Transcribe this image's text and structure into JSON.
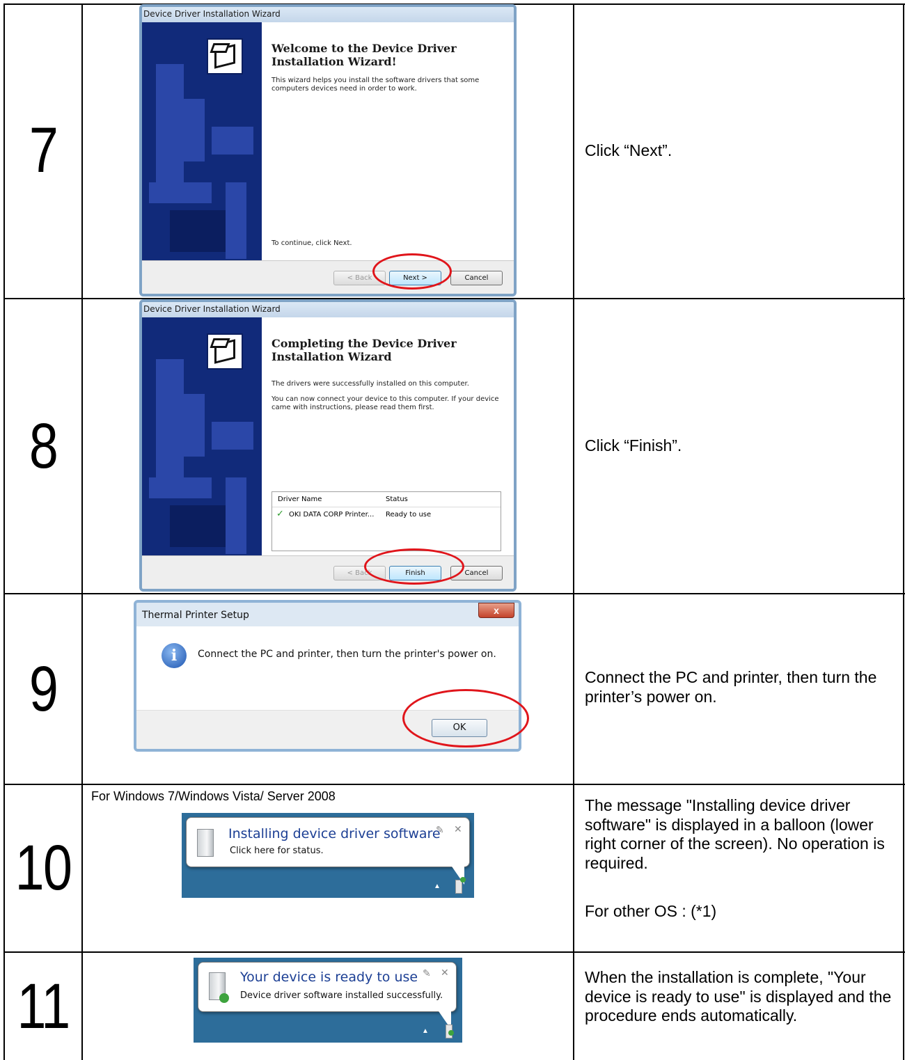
{
  "steps": [
    {
      "number": "7",
      "wizard": {
        "title": "Device Driver Installation Wizard",
        "heading": "Welcome to the Device Driver Installation Wizard!",
        "text": "This wizard helps you install the software drivers that some computers devices need in order to work.",
        "footer_text": "To continue, click Next.",
        "back_label": "< Back",
        "next_label": "Next >",
        "cancel_label": "Cancel"
      },
      "instruction": "Click “Next”."
    },
    {
      "number": "8",
      "wizard": {
        "title": "Device Driver Installation Wizard",
        "heading": "Completing the Device Driver Installation Wizard",
        "text1": "The drivers were successfully installed on this computer.",
        "text2": "You can now connect your device to this computer. If your device came with instructions, please read them first.",
        "list_header_name": "Driver Name",
        "list_header_status": "Status",
        "driver_name": "OKI DATA CORP Printer...",
        "driver_status": "Ready to use",
        "back_label": "< Back",
        "finish_label": "Finish",
        "cancel_label": "Cancel"
      },
      "instruction": "Click “Finish”."
    },
    {
      "number": "9",
      "msgbox": {
        "title": "Thermal Printer Setup",
        "close_label": "x",
        "message": "Connect the PC and printer, then turn the printer's power on.",
        "ok_label": "OK"
      },
      "instruction": "Connect the PC and printer, then turn the printer’s power on."
    },
    {
      "number": "10",
      "note": "For Windows 7/Windows Vista/ Server 2008",
      "balloon": {
        "title": "Installing device driver software",
        "subtitle": "Click here for status."
      },
      "instruction": "The message \"Installing device driver software\" is displayed in a balloon (lower right corner of the screen). No operation is required.",
      "instruction2": "For other OS : (*1)"
    },
    {
      "number": "11",
      "balloon": {
        "title": "Your device is ready to use",
        "subtitle": "Device driver software installed successfully."
      },
      "instruction": "When the installation is complete, \"Your device is ready to use\" is displayed and the procedure ends automatically."
    }
  ],
  "colors": {
    "highlight": "#e0151b",
    "wizard_panel": "#112a7a",
    "tray": "#2d6d9a"
  }
}
